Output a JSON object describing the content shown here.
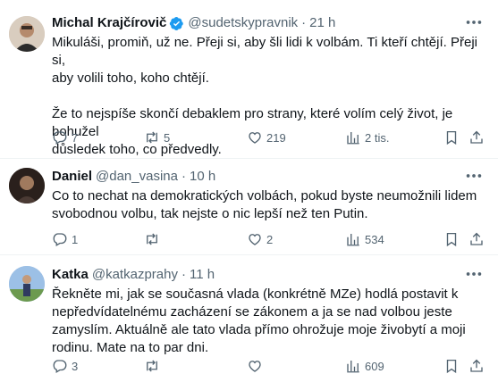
{
  "tweets": [
    {
      "name": "Michal Krajčírovič",
      "handle": "@sudetskypravnik",
      "time": "21 h",
      "text": "Mikuláši, promiň, už ne. Přeji si, aby šli lidi k volbám. Ti kteří chtějí. Přeji si,\naby volili toho, koho chtějí.\n\nŽe to nejspíše skončí debaklem pro strany, které volím celý život, je bohužel\ndůsledek toho, co předvedly.",
      "replies": "7",
      "reposts": "5",
      "likes": "219",
      "views": "2 tis."
    },
    {
      "name": "Daniel",
      "handle": "@dan_vasina",
      "time": "10 h",
      "text": "Co to nechat na demokratických volbách, pokud byste neumožnili lidem\nsvobodnou volbu, tak nejste o nic lepší než ten Putin.",
      "replies": "1",
      "reposts": "",
      "likes": "2",
      "views": "534"
    },
    {
      "name": "Katka",
      "handle": "@katkazprahy",
      "time": "11 h",
      "text": "Řekněte mi, jak se současná vlada (konkrétně MZe) hodlá postavit k\nnepředvídatelnému zacházení se zákonem a ja se nad volbou jeste\nzamyslím. Aktuálně ale tato vlada přímo ohrožuje moje živobytí a moji\nrodinu. Mate na to par dni.",
      "replies": "3",
      "reposts": "",
      "likes": "",
      "views": "609"
    }
  ],
  "separator": "·",
  "colors": {
    "verified": "#1d9bf0",
    "secondary_text": "#536471",
    "divider": "#eff3f4"
  },
  "icons": [
    "verified-badge-icon",
    "more-icon",
    "reply-icon",
    "repost-icon",
    "like-icon",
    "views-icon",
    "bookmark-icon",
    "share-icon"
  ]
}
